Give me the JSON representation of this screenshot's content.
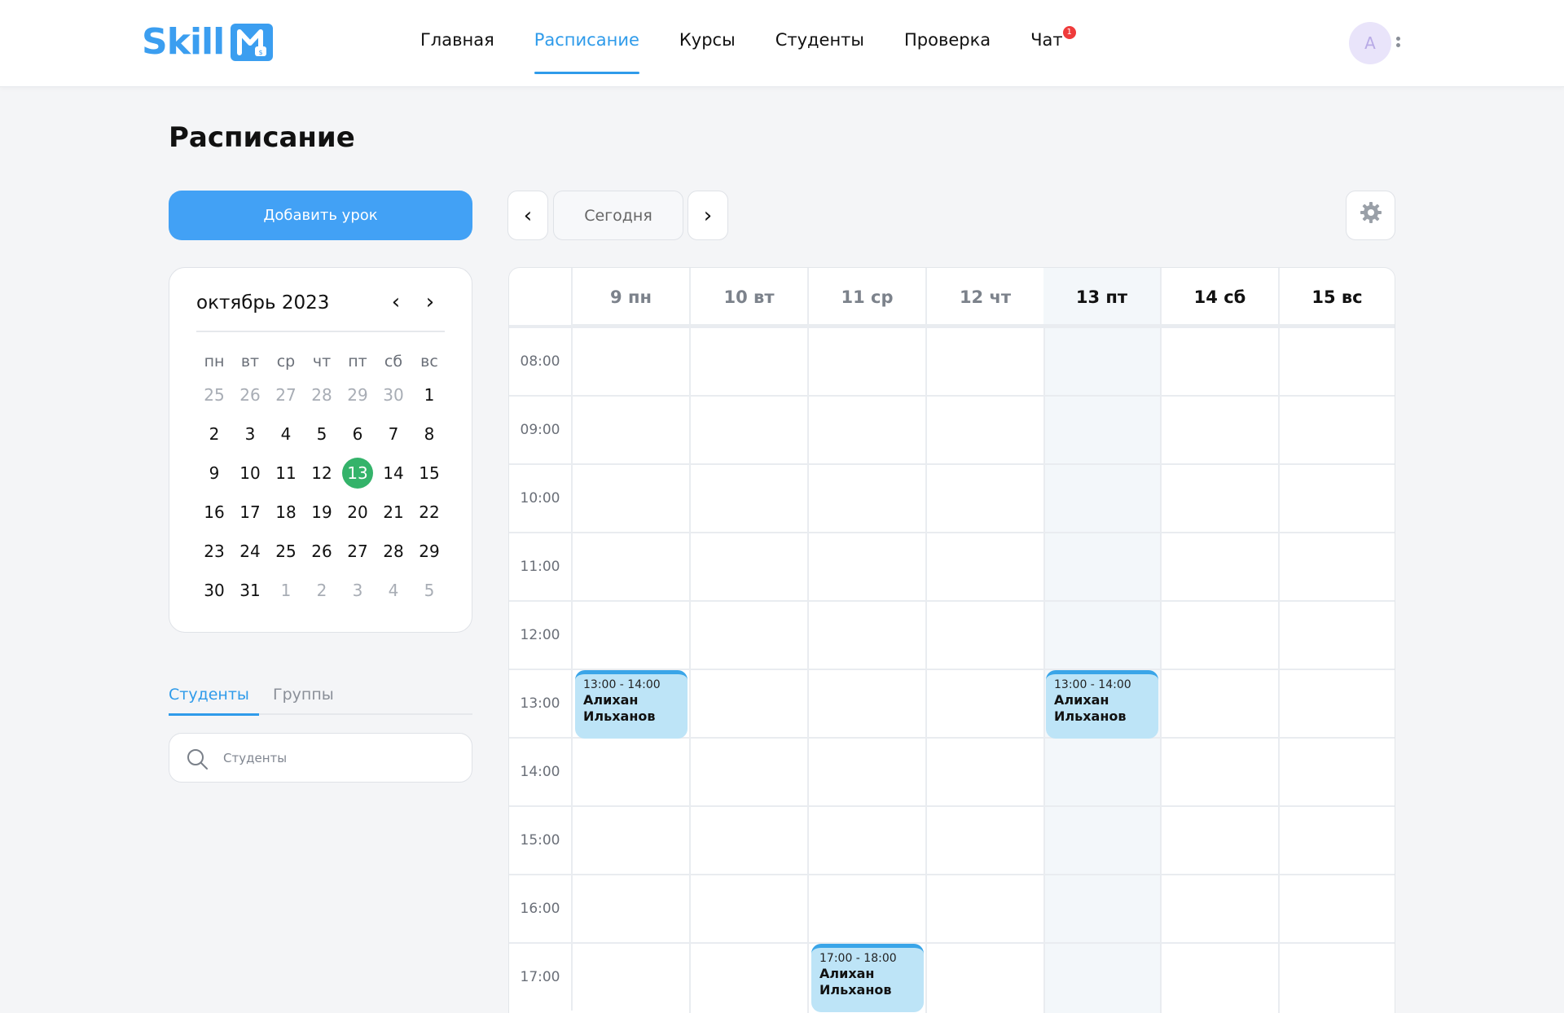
{
  "brand": {
    "text": "Skill",
    "accent": "#3b9ef0"
  },
  "nav": {
    "items": [
      {
        "label": "Главная"
      },
      {
        "label": "Расписание",
        "active": true
      },
      {
        "label": "Курсы"
      },
      {
        "label": "Студенты"
      },
      {
        "label": "Проверка"
      },
      {
        "label": "Чат",
        "badge": "1"
      }
    ]
  },
  "user": {
    "avatar_initial": "A"
  },
  "page": {
    "title": "Расписание"
  },
  "actions": {
    "add_lesson": "Добавить урок"
  },
  "mini_calendar": {
    "title": "октябрь 2023",
    "prev_icon": "chevron-left-icon",
    "next_icon": "chevron-right-icon",
    "weekdays": [
      "пн",
      "вт",
      "ср",
      "чт",
      "пт",
      "сб",
      "вс"
    ],
    "weeks": [
      [
        "25",
        "26",
        "27",
        "28",
        "29",
        "30",
        "1"
      ],
      [
        "2",
        "3",
        "4",
        "5",
        "6",
        "7",
        "8"
      ],
      [
        "9",
        "10",
        "11",
        "12",
        "13",
        "14",
        "15"
      ],
      [
        "16",
        "17",
        "18",
        "19",
        "20",
        "21",
        "22"
      ],
      [
        "23",
        "24",
        "25",
        "26",
        "27",
        "28",
        "29"
      ],
      [
        "30",
        "31",
        "1",
        "2",
        "3",
        "4",
        "5"
      ]
    ],
    "today": "13",
    "today_color": "#34b36a"
  },
  "tabs": {
    "students": "Студенты",
    "groups": "Группы"
  },
  "search": {
    "placeholder": "Студенты",
    "icon": "search-icon"
  },
  "toolbar": {
    "prev": "‹",
    "today": "Сегодня",
    "next": "›",
    "settings_icon": "gear-icon"
  },
  "week": {
    "days": [
      {
        "label": "9 пн"
      },
      {
        "label": "10 вт"
      },
      {
        "label": "11 ср"
      },
      {
        "label": "12 чт"
      },
      {
        "label": "13 пт",
        "current": true
      },
      {
        "label": "14 сб"
      },
      {
        "label": "15 вс"
      }
    ],
    "hours": [
      "08:00",
      "09:00",
      "10:00",
      "11:00",
      "12:00",
      "13:00",
      "14:00",
      "15:00",
      "16:00",
      "17:00"
    ],
    "events": [
      {
        "day": 0,
        "start": "13:00",
        "time": "13:00 - 14:00",
        "name_line1": "Алихан",
        "name_line2": "Ильханов"
      },
      {
        "day": 4,
        "start": "13:00",
        "time": "13:00 - 14:00",
        "name_line1": "Алихан",
        "name_line2": "Ильханов"
      },
      {
        "day": 2,
        "start": "17:00",
        "time": "17:00 - 18:00",
        "name_line1": "Алихан",
        "name_line2": "Ильханов"
      }
    ],
    "event_color": "#bde4f7",
    "event_accent": "#3aa5e8"
  }
}
